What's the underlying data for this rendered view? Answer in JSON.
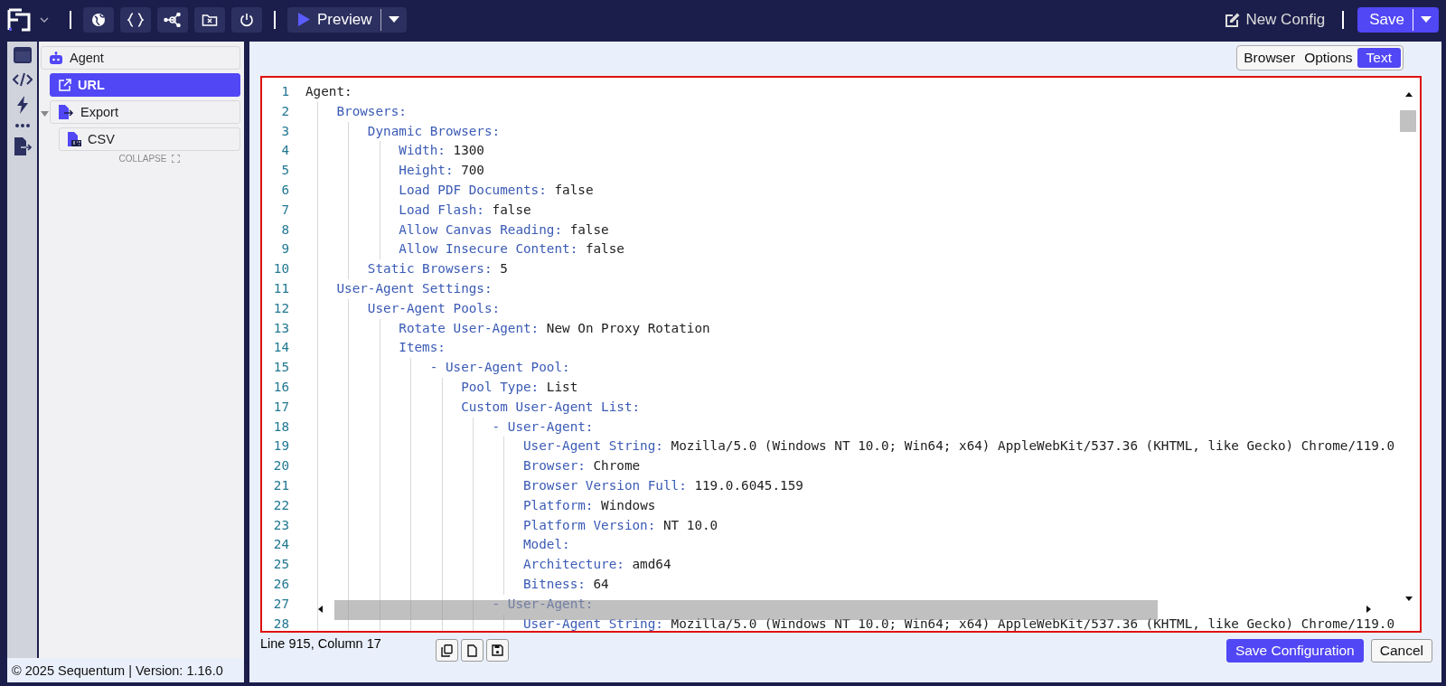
{
  "toolbar": {
    "preview": "Preview",
    "new_config": "New Config",
    "save": "Save"
  },
  "sidebar": {
    "tree": [
      {
        "label": "Agent",
        "kind": "agent",
        "selected": false,
        "children": [
          {
            "label": "URL",
            "kind": "url",
            "selected": true
          },
          {
            "label": "Export",
            "kind": "export",
            "selected": false,
            "expanded": true,
            "children": [
              {
                "label": "CSV",
                "kind": "csv",
                "selected": false
              }
            ]
          }
        ]
      }
    ],
    "collapse": "COLLAPSE",
    "footer": "© 2025 Sequentum | Version: 1.16.0"
  },
  "view_tabs": [
    {
      "label": "Browser",
      "selected": false
    },
    {
      "label": "Options",
      "selected": false
    },
    {
      "label": "Text",
      "selected": true
    }
  ],
  "editor": {
    "lines": [
      {
        "number": "1",
        "key": "Agent:"
      },
      {
        "number": "2",
        "key": "    Browsers:"
      },
      {
        "number": "3",
        "key": "        Dynamic Browsers:"
      },
      {
        "number": "4",
        "key": "            Width:",
        "value": "1300"
      },
      {
        "number": "5",
        "key": "            Height:",
        "value": "700"
      },
      {
        "number": "6",
        "key": "            Load PDF Documents:",
        "value": "false"
      },
      {
        "number": "7",
        "key": "            Load Flash:",
        "value": "false"
      },
      {
        "number": "8",
        "key": "            Allow Canvas Reading:",
        "value": "false"
      },
      {
        "number": "9",
        "key": "            Allow Insecure Content:",
        "value": "false"
      },
      {
        "number": "10",
        "key": "        Static Browsers:",
        "value": "5"
      },
      {
        "number": "11",
        "key": "    User-Agent Settings:"
      },
      {
        "number": "12",
        "key": "        User-Agent Pools:"
      },
      {
        "number": "13",
        "key": "            Rotate User-Agent:",
        "value": "New On Proxy Rotation"
      },
      {
        "number": "14",
        "key": "            Items:"
      },
      {
        "number": "15",
        "key": "                - User-Agent Pool:"
      },
      {
        "number": "16",
        "key": "                    Pool Type:",
        "value": "List"
      },
      {
        "number": "17",
        "key": "                    Custom User-Agent List:"
      },
      {
        "number": "18",
        "key": "                        - User-Agent:"
      },
      {
        "number": "19",
        "key": "                            User-Agent String:",
        "value": "Mozilla/5.0 (Windows NT 10.0; Win64; x64) AppleWebKit/537.36 (KHTML, like Gecko) Chrome/119.0"
      },
      {
        "number": "20",
        "key": "                            Browser:",
        "value": "Chrome"
      },
      {
        "number": "21",
        "key": "                            Browser Version Full:",
        "value": "119.0.6045.159"
      },
      {
        "number": "22",
        "key": "                            Platform:",
        "value": "Windows"
      },
      {
        "number": "23",
        "key": "                            Platform Version:",
        "value": "NT 10.0"
      },
      {
        "number": "24",
        "key": "                            Model:"
      },
      {
        "number": "25",
        "key": "                            Architecture:",
        "value": "amd64"
      },
      {
        "number": "26",
        "key": "                            Bitness:",
        "value": "64"
      },
      {
        "number": "27",
        "key": "                        - User-Agent:"
      },
      {
        "number": "28",
        "key": "                            User-Agent String:",
        "value": "Mozilla/5.0 (Windows NT 10.0; Win64; x64) AppleWebKit/537.36 (KHTML, like Gecko) Chrome/119.0"
      }
    ]
  },
  "status": "Line 915, Column 17",
  "buttons": [
    "Save Configuration",
    "Cancel"
  ]
}
